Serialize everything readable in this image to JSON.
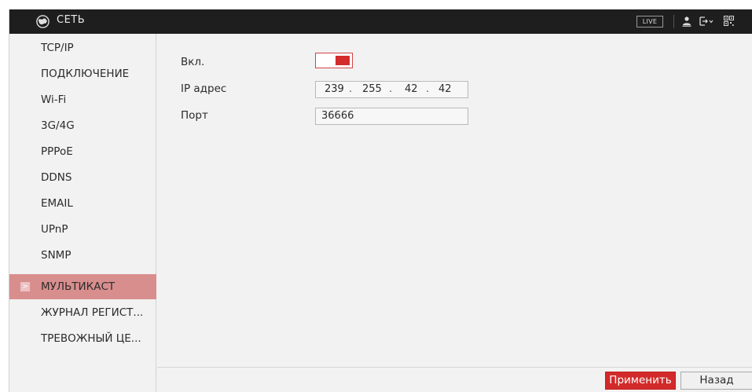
{
  "app": {
    "title": "СЕТЬ",
    "live_label": "LIVE"
  },
  "sidebar": {
    "items": [
      {
        "label": "TCP/IP"
      },
      {
        "label": "ПОДКЛЮЧЕНИЕ"
      },
      {
        "label": "Wi-Fi"
      },
      {
        "label": "3G/4G"
      },
      {
        "label": "PPPoE"
      },
      {
        "label": "DDNS"
      },
      {
        "label": "EMAIL"
      },
      {
        "label": "UPnP"
      },
      {
        "label": "SNMP"
      },
      {
        "label": "МУЛЬТИКАСТ",
        "active": true
      },
      {
        "label": "ЖУРНАЛ РЕГИСТ..."
      },
      {
        "label": "ТРЕВОЖНЫЙ ЦЕ..."
      }
    ],
    "active_arrow": ">"
  },
  "form": {
    "enable_label": "Вкл.",
    "enable_on": true,
    "ip_label": "IP адрес",
    "ip": [
      "239",
      "255",
      "42",
      "42"
    ],
    "ip_separator": ".",
    "port_label": "Порт",
    "port_value": "36666"
  },
  "buttons": {
    "apply": "Применить",
    "back": "Назад"
  },
  "colors": {
    "topbar": "#1e1e1e",
    "active_item": "#d98e8e",
    "accent": "#d22a2a"
  },
  "icons": {
    "logo": "globe-logo-icon",
    "user": "user-icon",
    "logout": "logout-icon",
    "qr": "qr-code-icon"
  }
}
